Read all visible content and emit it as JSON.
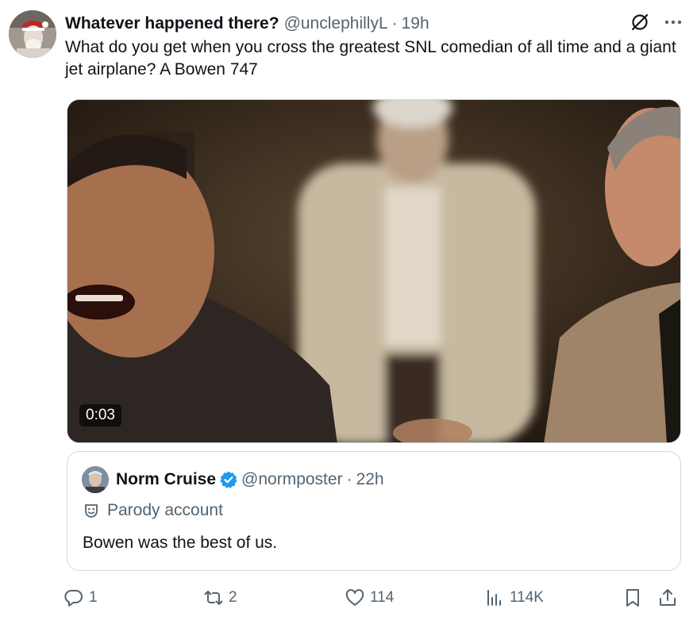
{
  "tweet": {
    "display_name": "Whatever happened there?",
    "handle": "@unclephillyL",
    "separator": "·",
    "time": "19h",
    "text": "What do you get when you cross the greatest SNL comedian of all time and a giant jet airplane? A Bowen 747"
  },
  "video": {
    "duration": "0:03"
  },
  "quoted_tweet": {
    "display_name": "Norm Cruise",
    "handle": "@normposter",
    "separator": "·",
    "time": "22h",
    "label": "Parody account",
    "text": "Bowen was the best of us."
  },
  "actions": {
    "replies": "1",
    "retweets": "2",
    "likes": "114",
    "views": "114K"
  },
  "colors": {
    "text_primary": "#0f1419",
    "text_secondary": "#536471",
    "border": "#cfd9de",
    "verified_blue": "#1d9bf0"
  },
  "icons": [
    "grok-icon",
    "more-icon",
    "verified-icon",
    "parody-mask-icon",
    "reply-icon",
    "retweet-icon",
    "like-icon",
    "views-icon",
    "bookmark-icon",
    "share-icon"
  ]
}
